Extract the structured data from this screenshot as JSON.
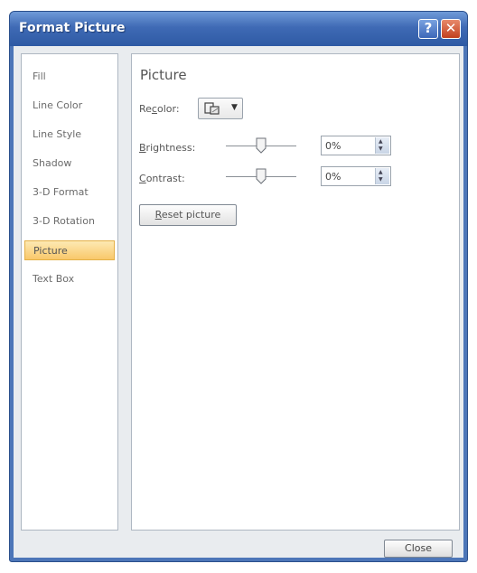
{
  "window": {
    "title": "Format Picture",
    "help_label": "?",
    "close_label": "✕"
  },
  "nav": {
    "items": [
      {
        "label": "Fill"
      },
      {
        "label": "Line Color"
      },
      {
        "label": "Line Style"
      },
      {
        "label": "Shadow"
      },
      {
        "label": "3-D Format"
      },
      {
        "label": "3-D Rotation"
      },
      {
        "label": "Picture",
        "selected": true
      },
      {
        "label": "Text Box"
      }
    ]
  },
  "panel": {
    "heading": "Picture",
    "recolor": {
      "label_pre": "Re",
      "label_key": "c",
      "label_post": "olor:"
    },
    "brightness": {
      "label_key": "B",
      "label_post": "rightness:",
      "value": "0%"
    },
    "contrast": {
      "label_key": "C",
      "label_post": "ontrast:",
      "value": "0%"
    },
    "reset_key": "R",
    "reset_post": "eset picture"
  },
  "footer": {
    "close_label": "Close"
  }
}
